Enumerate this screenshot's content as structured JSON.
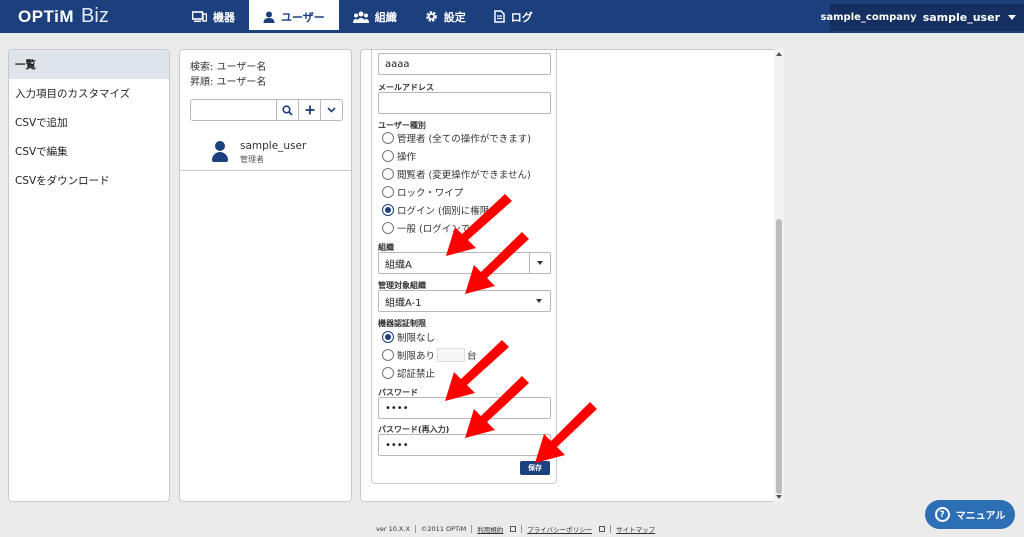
{
  "header": {
    "logo_main": "OPTiM",
    "logo_sub": "Biz",
    "nav": [
      {
        "label": "機器",
        "icon": "device-icon"
      },
      {
        "label": "ユーザー",
        "icon": "user-icon",
        "active": true
      },
      {
        "label": "組織",
        "icon": "organization-icon"
      },
      {
        "label": "設定",
        "icon": "gear-icon"
      },
      {
        "label": "ログ",
        "icon": "log-icon"
      }
    ],
    "company": "sample_company",
    "user": "sample_user"
  },
  "sidebar": {
    "items": [
      "一覧",
      "入力項目のカスタマイズ",
      "CSVで追加",
      "CSVで編集",
      "CSVをダウンロード"
    ]
  },
  "user_list": {
    "search_label": "検索: ユーザー名",
    "sort_label": "昇順: ユーザー名",
    "search_value": "",
    "users": [
      {
        "name": "sample_user",
        "role": "管理者"
      }
    ]
  },
  "form": {
    "name_value": "aaaa",
    "email_label": "メールアドレス",
    "email_value": "",
    "user_type_label": "ユーザー種別",
    "user_types": [
      "管理者 (全ての操作ができます)",
      "操作",
      "閲覧者 (変更操作ができません)",
      "ロック・ワイプ",
      "ログイン (個別に権限を",
      "一般 (ログインで"
    ],
    "user_type_selected": 4,
    "org_label": "組織",
    "org_value": "組織A",
    "managed_org_label": "管理対象組織",
    "managed_org_value": "組織A-1",
    "device_limit_label": "機器認証制限",
    "limit_none": "制限なし",
    "limit_some": "制限あり",
    "limit_unit": "台",
    "limit_ban": "認証禁止",
    "limit_selected": 0,
    "password_label": "パスワード",
    "password_value": "••••",
    "password_confirm_label": "パスワード(再入力)",
    "password_confirm_value": "••••",
    "save_label": "保存"
  },
  "footer": {
    "version": "ver 10.X.X",
    "copyright": "©2011 OPTiM",
    "terms": "利用規約",
    "privacy": "プライバシーポリシー",
    "sitemap": "サイトマップ"
  },
  "manual_label": "マニュアル",
  "colors": {
    "brand": "#1c3f7d",
    "arrow": "#ff0000",
    "manual": "#2c6fb5"
  }
}
